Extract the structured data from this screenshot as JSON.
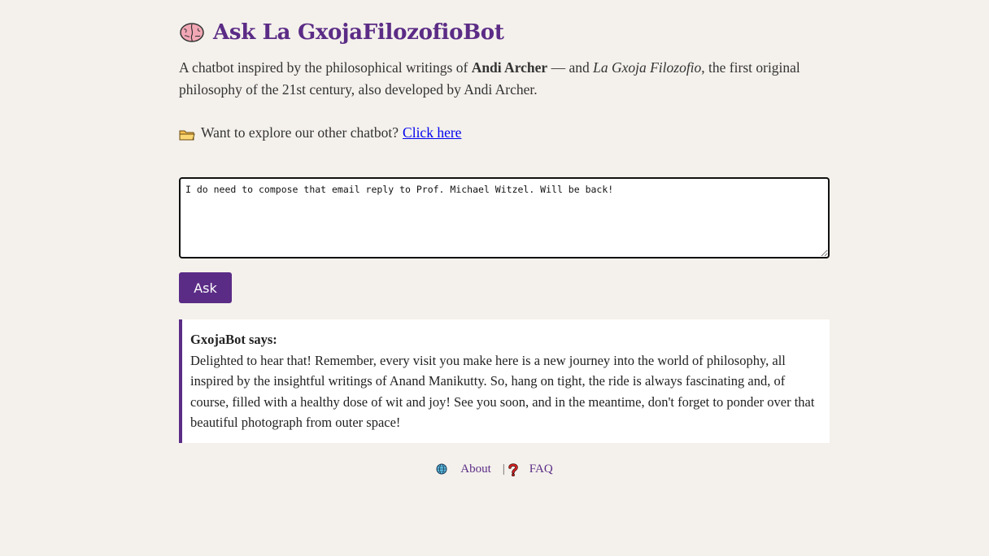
{
  "header": {
    "icon": "brain-icon",
    "title": "Ask La GxojaFilozofioBot"
  },
  "intro": {
    "prefix": "A chatbot inspired by the philosophical writings of ",
    "author_bold": "Andi Archer",
    "middle": " — and ",
    "work_italic": "La Gxoja Filozofio",
    "suffix": ", the first original philosophy of the 21st century, also developed by Andi Archer."
  },
  "explore": {
    "icon": "folder-icon",
    "text": "Want to explore our other chatbot?",
    "link_label": "Click here"
  },
  "question": {
    "value": "I do need to compose that email reply to Prof. Michael Witzel. Will be back!"
  },
  "ask_button": {
    "label": "Ask"
  },
  "answer": {
    "speaker": "GxojaBot says:",
    "text": "Delighted to hear that! Remember, every visit you make here is a new journey into the world of philosophy, all inspired by the insightful writings of Anand Manikutty. So, hang on tight, the ride is always fascinating and, of course, filled with a healthy dose of wit and joy! See you soon, and in the meantime, don't forget to ponder over that beautiful photograph from outer space!"
  },
  "footer": {
    "about_icon": "globe-icon",
    "about_label": "About",
    "separator": "|",
    "faq_icon": "question-mark-icon",
    "faq_label": "FAQ"
  },
  "colors": {
    "accent": "#5b2c86",
    "background": "#f4f1ec",
    "link": "#0000ee"
  }
}
